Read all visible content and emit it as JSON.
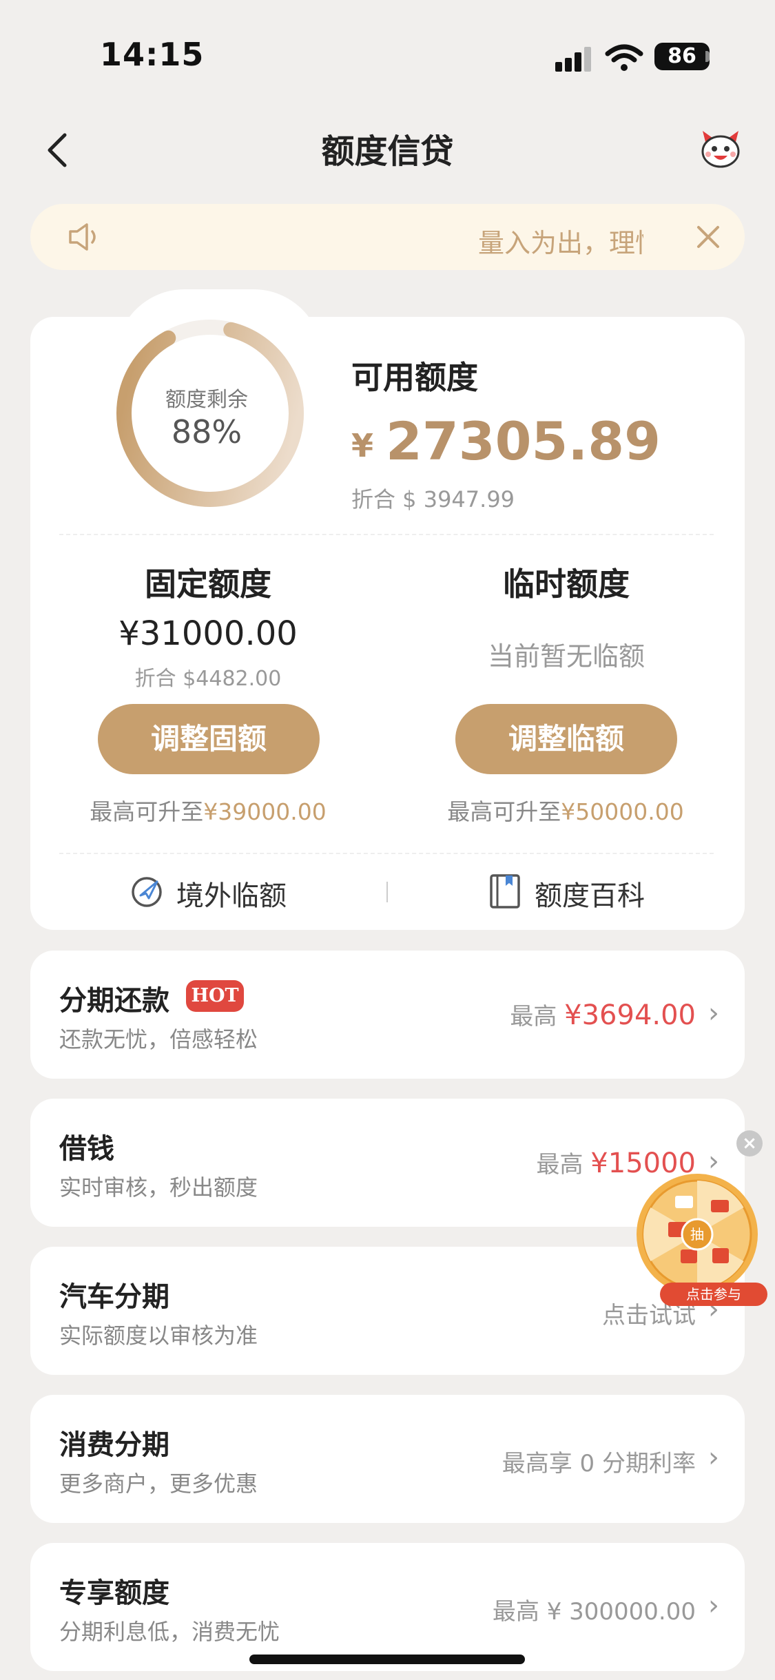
{
  "status_bar": {
    "time": "14:15",
    "battery": "86"
  },
  "nav": {
    "title": "额度信贷"
  },
  "notice": {
    "text": "量入为出，理性消费"
  },
  "summary": {
    "ring_label": "额度剩余",
    "ring_percent": "88%",
    "ring_fraction": 0.88,
    "available_label": "可用额度",
    "currency_symbol": "¥",
    "available_amount": "27305.89",
    "converted": "折合 $ 3947.99"
  },
  "fixed": {
    "title": "固定额度",
    "amount": "¥31000.00",
    "converted": "折合 $4482.00",
    "button": "调整固额",
    "max_prefix": "最高可升至",
    "max_amount": "¥39000.00"
  },
  "temporary": {
    "title": "临时额度",
    "status": "当前暂无临额",
    "button": "调整临额",
    "max_prefix": "最高可升至",
    "max_amount": "¥50000.00"
  },
  "shortcuts": [
    {
      "label": "境外临额",
      "icon": "plane-icon"
    },
    {
      "label": "额度百科",
      "icon": "book-icon"
    }
  ],
  "products": [
    {
      "title": "分期还款",
      "badge": "HOT",
      "subtitle": "还款无忧，倍感轻松",
      "right_prefix": "最高",
      "right_amount": "¥3694.00"
    },
    {
      "title": "借钱",
      "subtitle": "实时审核，秒出额度",
      "right_prefix": "最高",
      "right_amount": "¥15000"
    },
    {
      "title": "汽车分期",
      "subtitle": "实际额度以审核为准",
      "right_text": "点击试试"
    },
    {
      "title": "消费分期",
      "subtitle": "更多商户，更多优惠",
      "right_text": "最高享 0 分期利率"
    },
    {
      "title": "专享额度",
      "subtitle": "分期利息低，消费无忧",
      "right_text": "最高 ¥ 300000.00"
    }
  ],
  "promo": {
    "center": "抽",
    "label": "点击参与"
  },
  "colors": {
    "accent": "#c79f6e",
    "amount_gold": "#b8926a",
    "red": "#e35050",
    "background": "#f1efed"
  }
}
